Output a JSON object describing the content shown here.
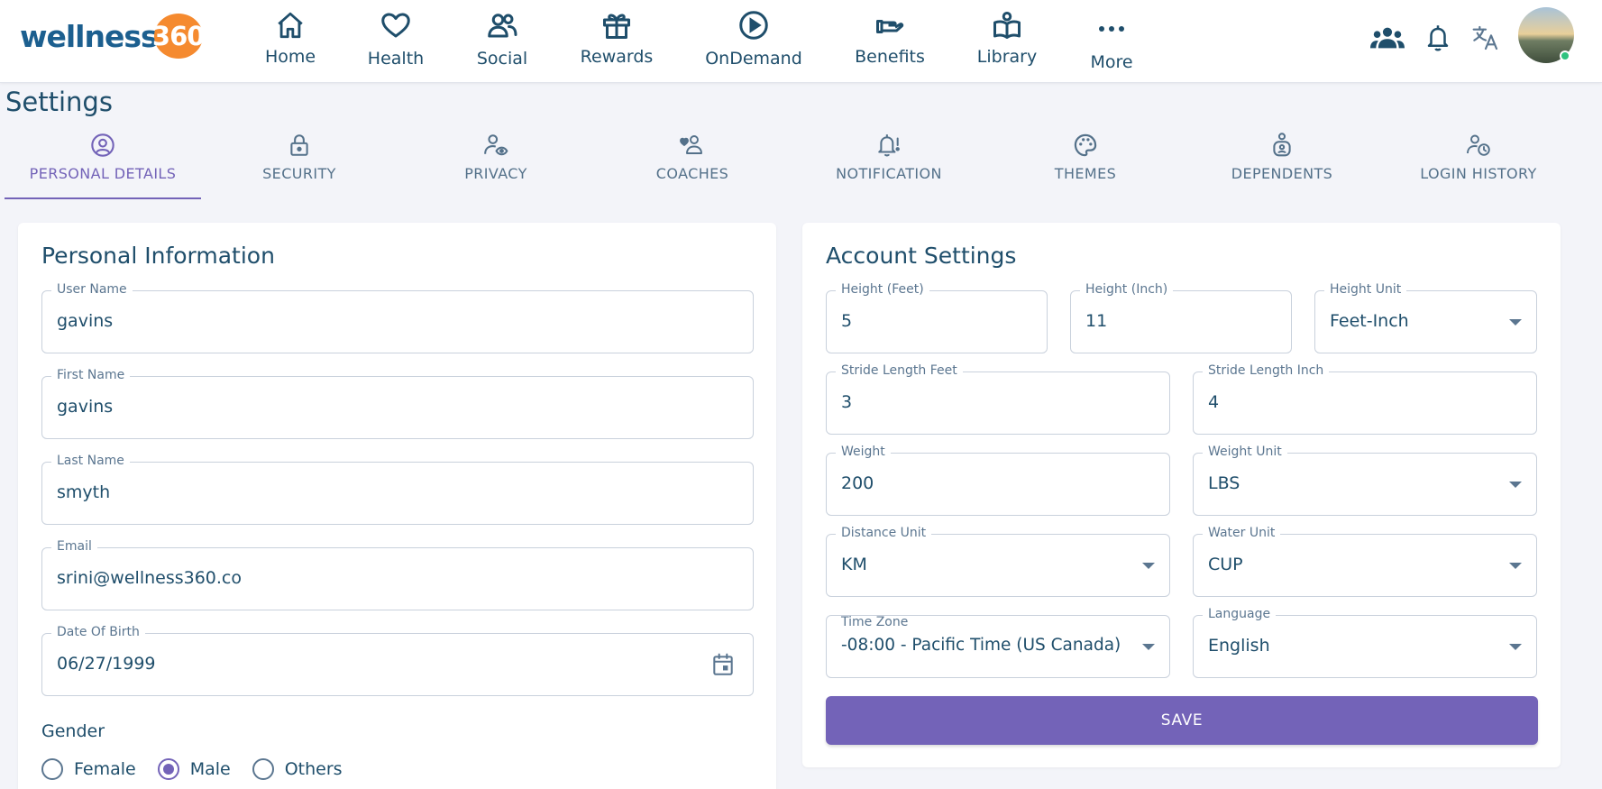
{
  "brand": {
    "logo_text": "wellness",
    "logo_badge": "360",
    "accent": "#f58a2f",
    "brand_blue": "#1c5f8f"
  },
  "nav": [
    {
      "label": "Home",
      "icon": "home-icon"
    },
    {
      "label": "Health",
      "icon": "heart-icon"
    },
    {
      "label": "Social",
      "icon": "people-icon"
    },
    {
      "label": "Rewards",
      "icon": "gift-icon"
    },
    {
      "label": "OnDemand",
      "icon": "play-circle-icon"
    },
    {
      "label": "Benefits",
      "icon": "hand-icon"
    },
    {
      "label": "Library",
      "icon": "book-icon"
    },
    {
      "label": "More",
      "icon": "more-dots-icon"
    }
  ],
  "header_icons": [
    "group-icon",
    "bell-icon",
    "translate-icon",
    "avatar"
  ],
  "page": {
    "title": "Settings"
  },
  "tabs": [
    {
      "label": "PERSONAL DETAILS",
      "icon": "user-circle-icon",
      "active": true
    },
    {
      "label": "SECURITY",
      "icon": "lock-icon",
      "active": false
    },
    {
      "label": "PRIVACY",
      "icon": "user-eye-icon",
      "active": false
    },
    {
      "label": "COACHES",
      "icon": "user-heart-icon",
      "active": false
    },
    {
      "label": "NOTIFICATION",
      "icon": "bell-alert-icon",
      "active": false
    },
    {
      "label": "THEMES",
      "icon": "palette-icon",
      "active": false
    },
    {
      "label": "DEPENDENTS",
      "icon": "user-badge-icon",
      "active": false
    },
    {
      "label": "LOGIN HISTORY",
      "icon": "user-clock-icon",
      "active": false
    }
  ],
  "personal": {
    "title": "Personal Information",
    "username": {
      "label": "User Name",
      "value": "gavins"
    },
    "first_name": {
      "label": "First Name",
      "value": "gavins"
    },
    "last_name": {
      "label": "Last Name",
      "value": "smyth"
    },
    "email": {
      "label": "Email",
      "value": "srini@wellness360.co"
    },
    "dob": {
      "label": "Date Of Birth",
      "value": "06/27/1999"
    },
    "gender": {
      "label": "Gender",
      "options": [
        "Female",
        "Male",
        "Others"
      ],
      "selected": "Male"
    }
  },
  "account": {
    "title": "Account Settings",
    "height_feet": {
      "label": "Height (Feet)",
      "value": "5"
    },
    "height_inch": {
      "label": "Height (Inch)",
      "value": "11"
    },
    "height_unit": {
      "label": "Height Unit",
      "value": "Feet-Inch"
    },
    "stride_feet": {
      "label": "Stride Length Feet",
      "value": "3"
    },
    "stride_inch": {
      "label": "Stride Length Inch",
      "value": "4"
    },
    "weight": {
      "label": "Weight",
      "value": "200"
    },
    "weight_unit": {
      "label": "Weight Unit",
      "value": "LBS"
    },
    "distance_unit": {
      "label": "Distance Unit",
      "value": "KM"
    },
    "water_unit": {
      "label": "Water Unit",
      "value": "CUP"
    },
    "time_zone": {
      "label": "Time Zone",
      "value": "-08:00 - Pacific Time (US Canada)"
    },
    "language": {
      "label": "Language",
      "value": "English"
    },
    "save_label": "SAVE"
  },
  "colors": {
    "primary": "#7363b8",
    "text": "#1f4e6b",
    "muted": "#5b7690",
    "background": "#f3f4f9"
  }
}
